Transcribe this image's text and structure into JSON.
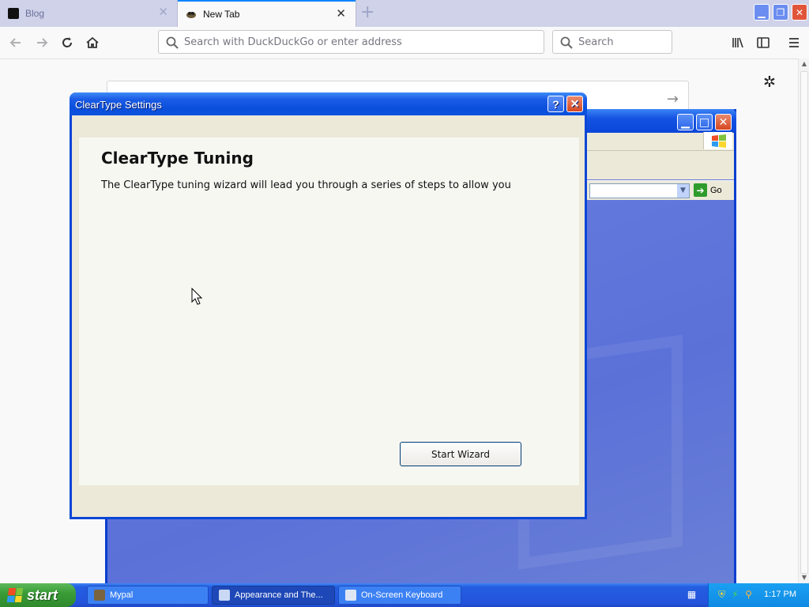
{
  "browser": {
    "tabs": [
      {
        "label": "Blog",
        "active": false
      },
      {
        "label": "New Tab",
        "active": true
      }
    ],
    "urlbar_placeholder": "Search with DuckDuckGo or enter address",
    "searchbar_placeholder": "Search",
    "accent_color": "#0a84ff"
  },
  "background_window": {
    "go_label": "Go"
  },
  "dialog": {
    "title": "ClearType Settings",
    "help_label": "?",
    "close_label": "✕",
    "heading": "ClearType Tuning",
    "description": "The ClearType tuning wizard will lead you through a series of steps to allow you",
    "start_button": "Start Wizard"
  },
  "taskbar": {
    "start_label": "start",
    "tasks": [
      {
        "label": "Mypal",
        "icon": "mypal-icon",
        "active": false
      },
      {
        "label": "Appearance and The...",
        "icon": "control-panel-icon",
        "active": true
      },
      {
        "label": "On-Screen Keyboard",
        "icon": "keyboard-icon",
        "active": false
      }
    ],
    "clock": "1:17 PM",
    "colors": {
      "bar": "#245ee0",
      "start": "#3a9c37",
      "tray": "#0f8ae3"
    }
  }
}
